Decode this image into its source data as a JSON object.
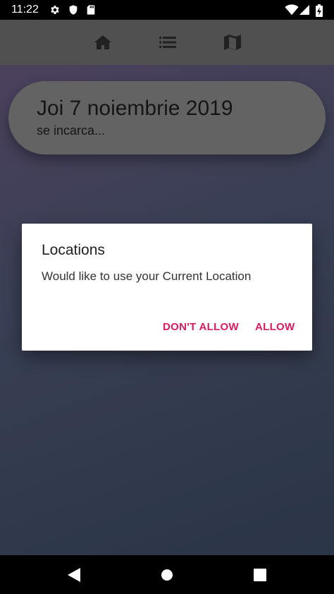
{
  "status_bar": {
    "time": "11:22",
    "icons": [
      "gear-icon",
      "shield-icon",
      "sd-card-icon",
      "wifi-icon",
      "signal-icon",
      "battery-charging-icon"
    ]
  },
  "toolbar": {
    "icons": [
      "home-icon",
      "list-icon",
      "map-icon"
    ],
    "background": "#6f6f6f"
  },
  "date_card": {
    "title": "Joi 7 noiembrie 2019",
    "subtitle": "se incarca..."
  },
  "dialog": {
    "title": "Locations",
    "message": "Would like to use your Current Location",
    "deny_label": "DON'T ALLOW",
    "allow_label": "ALLOW",
    "accent_color": "#d81b60"
  },
  "nav_bar": {
    "icons": [
      "back-icon",
      "home-circle-icon",
      "recents-icon"
    ]
  }
}
